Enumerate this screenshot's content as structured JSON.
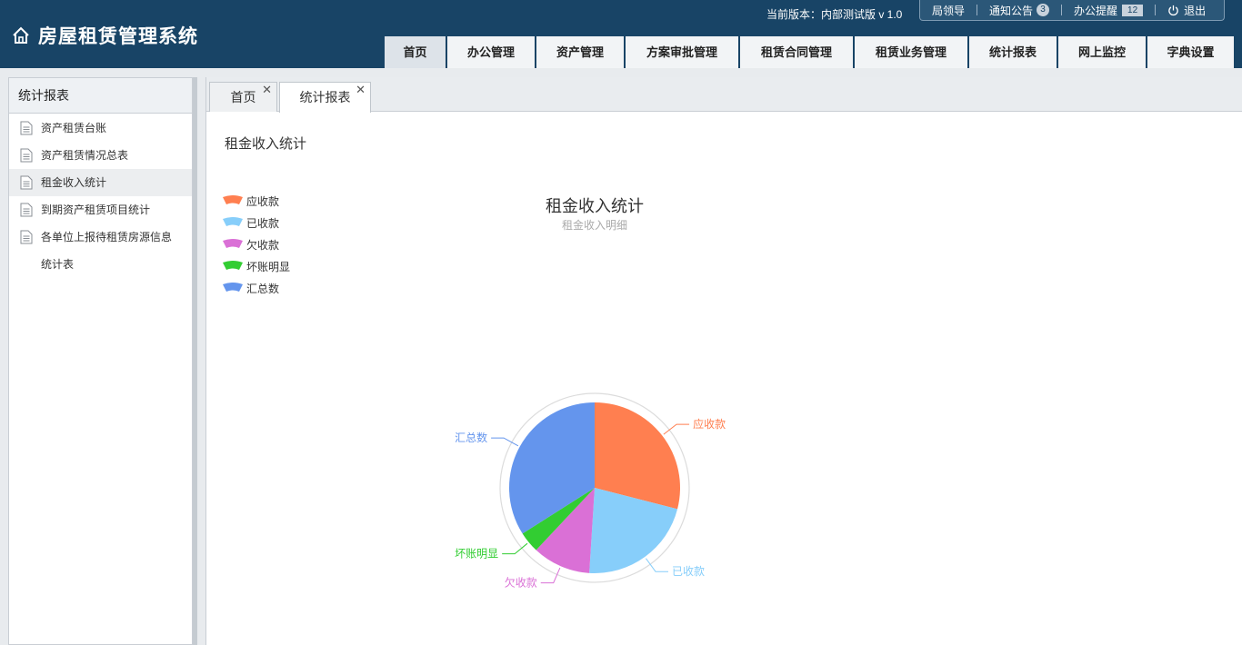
{
  "app": {
    "title": "房屋租赁管理系统",
    "version_text": "当前版本：内部测试版 v 1.0"
  },
  "topbar": {
    "leader": "局领导",
    "notice": "通知公告",
    "notice_count": "3",
    "reminder": "办公提醒",
    "reminder_count": "12",
    "logout": "退出"
  },
  "nav": {
    "items": [
      {
        "label": "首页"
      },
      {
        "label": "办公管理"
      },
      {
        "label": "资产管理"
      },
      {
        "label": "方案审批管理"
      },
      {
        "label": "租赁合同管理"
      },
      {
        "label": "租赁业务管理"
      },
      {
        "label": "统计报表"
      },
      {
        "label": "网上监控"
      },
      {
        "label": "字典设置"
      }
    ],
    "active": "首页"
  },
  "sidebar": {
    "title": "统计报表",
    "items": [
      {
        "label": "资产租赁台账"
      },
      {
        "label": "资产租赁情况总表"
      },
      {
        "label": "租金收入统计"
      },
      {
        "label": "到期资产租赁项目统计"
      },
      {
        "label": "各单位上报待租赁房源信息统计表"
      }
    ],
    "active": "租金收入统计"
  },
  "tabs": [
    {
      "label": "首页"
    },
    {
      "label": "统计报表"
    }
  ],
  "page": {
    "title": "租金收入统计"
  },
  "chart_data": {
    "type": "pie",
    "title": "租金收入统计",
    "subtitle": "租金收入明细",
    "legend_position": "top-left",
    "series": [
      {
        "name": "应收款",
        "value": 29,
        "color": "#ff7f50"
      },
      {
        "name": "已收款",
        "value": 22,
        "color": "#87cefa"
      },
      {
        "name": "欠收款",
        "value": 11,
        "color": "#da70d6"
      },
      {
        "name": "坏账明显",
        "value": 4,
        "color": "#32cd32"
      },
      {
        "name": "汇总数",
        "value": 34,
        "color": "#6495ed"
      }
    ]
  },
  "colors": {
    "header_bg": "#184466",
    "accent": "#184466"
  }
}
